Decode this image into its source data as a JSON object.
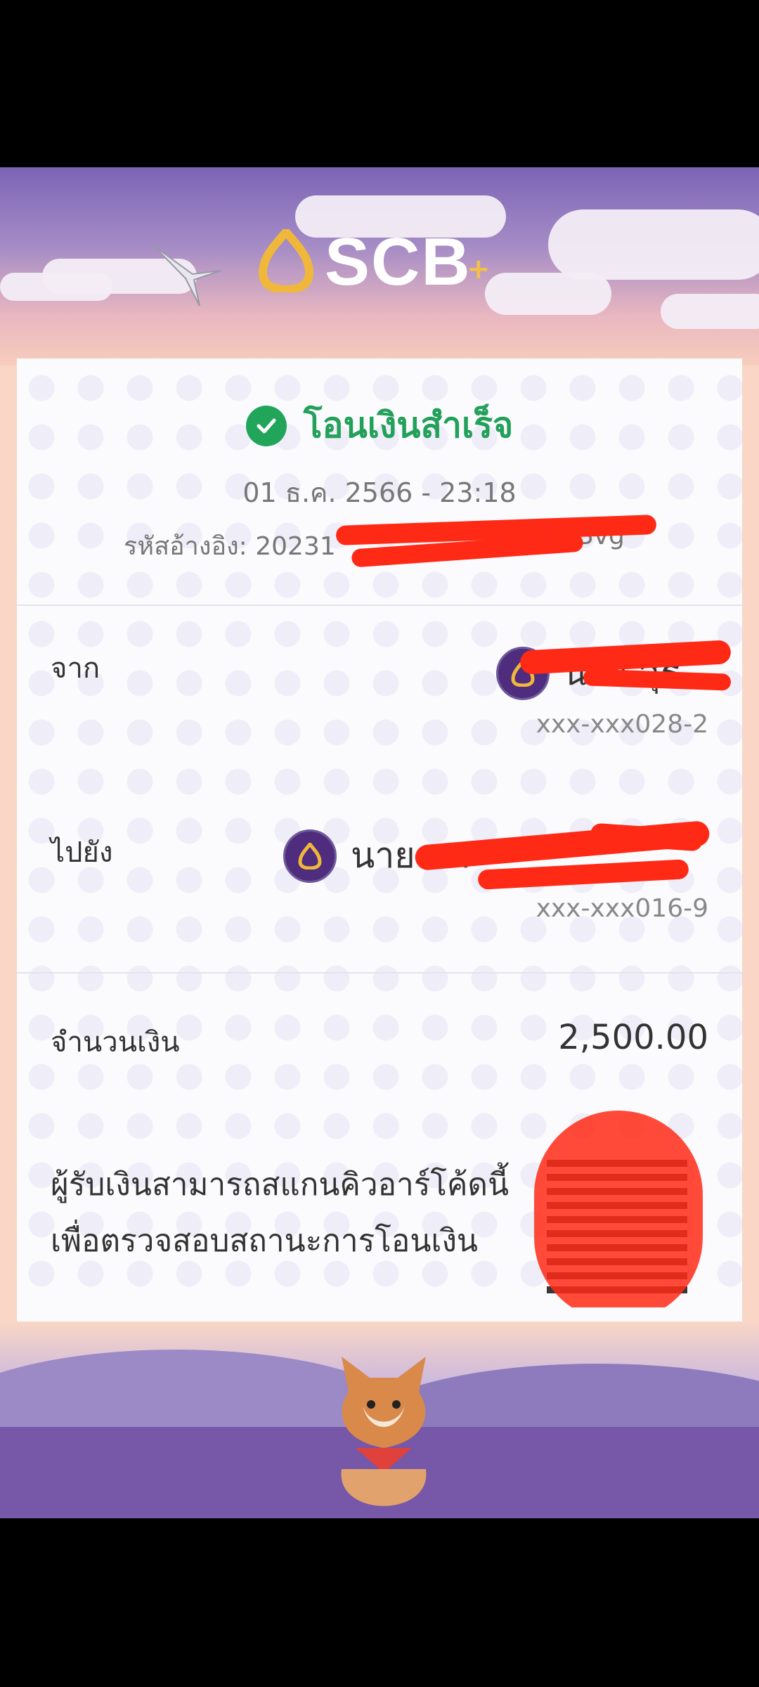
{
  "header": {
    "brand": "SCB",
    "brand_plus": "+"
  },
  "status": {
    "title": "โอนเงินสำเร็จ",
    "datetime": "01 ธ.ค. 2566 - 23:18"
  },
  "reference": {
    "label": "รหัสอ้างอิง:",
    "value_visible": "20231",
    "value_tail": "Bvg"
  },
  "from": {
    "label": "จาก",
    "name": "นาย สุธ",
    "account": "xxx-xxx028-2"
  },
  "to": {
    "label": "ไปยัง",
    "name": "นาย สม",
    "account": "xxx-xxx016-9"
  },
  "amount": {
    "label": "จำนวนเงิน",
    "value": "2,500.00"
  },
  "qr_note": {
    "line1": "ผู้รับเงินสามารถสแกนคิวอาร์โค้ดนี้",
    "line2": "เพื่อตรวจสอบสถานะการโอนเงิน"
  },
  "colors": {
    "success": "#23a05a",
    "brand_purple": "#4f2c7d",
    "brand_gold": "#f3c04a",
    "redaction": "#ff2a16"
  },
  "icons": {
    "status": "check-circle-icon",
    "bank": "scb-bank-icon",
    "logo": "scb-logo-icon"
  }
}
